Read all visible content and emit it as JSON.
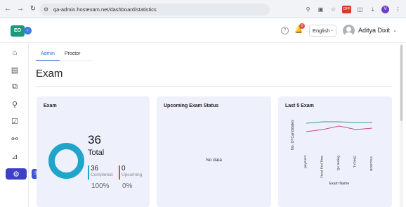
{
  "browser": {
    "url": "qa-admin.hostexam.net/dashboard/statistics",
    "ext_badge": "OFF",
    "profile_initial": "V"
  },
  "header": {
    "logo_text": "EO",
    "notification_count": "0",
    "language": "English",
    "user_name": "Aditya Dixit"
  },
  "sidebar": {
    "items": [
      {
        "icon": "home-icon"
      },
      {
        "icon": "book-icon"
      },
      {
        "icon": "copy-icon"
      },
      {
        "icon": "user-key-icon"
      },
      {
        "icon": "checkbox-icon"
      },
      {
        "icon": "person-icon"
      },
      {
        "icon": "chart-icon"
      },
      {
        "icon": "settings-icon"
      }
    ],
    "tooltip": "Settings"
  },
  "tabs": [
    "Admin",
    "Proctor"
  ],
  "page_title": "Exam",
  "exam_card": {
    "title": "Exam",
    "total": "36",
    "total_label": "Total",
    "completed_value": "36",
    "completed_label": "Completed",
    "completed_pct": "100%",
    "upcoming_value": "0",
    "upcoming_label": "Upcoming",
    "upcoming_pct": "0%",
    "completed_color": "#21a4c9",
    "upcoming_color": "#d8553a"
  },
  "upcoming_card": {
    "title": "Upcoming Exam Status",
    "empty_text": "No data"
  },
  "last5_card": {
    "title": "Last 5 Exam"
  },
  "chart_data": {
    "type": "line",
    "categories": [
      "payment",
      "Fixed End Time",
      "QA testing",
      "TYPING",
      "BOOTFUL"
    ],
    "series": [
      {
        "values": [
          40,
          42,
          42,
          41,
          41
        ],
        "color": "#3a9a8a"
      },
      {
        "values": [
          28,
          31,
          36,
          31,
          33
        ],
        "color": "#c94a8a"
      }
    ],
    "xlabel": "Exam Name",
    "ylabel": "No. Of Candidates",
    "ylim": [
      0,
      50
    ]
  }
}
